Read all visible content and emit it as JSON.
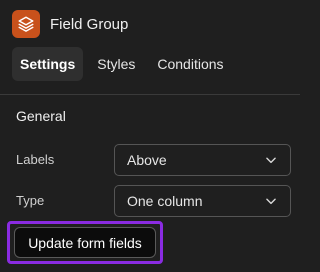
{
  "header": {
    "title": "Field Group",
    "icon": "layers-icon",
    "icon_bg": "#c8511b"
  },
  "tabs": [
    {
      "label": "Settings",
      "active": true
    },
    {
      "label": "Styles",
      "active": false
    },
    {
      "label": "Conditions",
      "active": false
    }
  ],
  "section": {
    "title": "General"
  },
  "fields": {
    "labels": {
      "label": "Labels",
      "value": "Above"
    },
    "type": {
      "label": "Type",
      "value": "One column"
    }
  },
  "actions": {
    "update_label": "Update form fields"
  },
  "colors": {
    "background": "#1f1f1f",
    "focus_ring": "#8a2be2",
    "accent": "#c8511b"
  }
}
